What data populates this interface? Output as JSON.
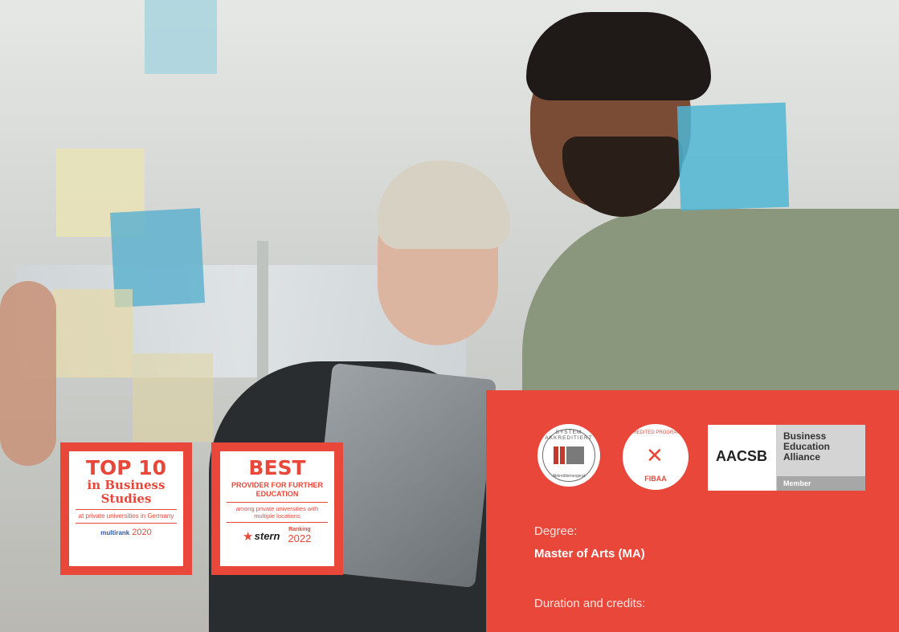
{
  "badges": {
    "top10": {
      "headline": "TOP 10",
      "subline": "in Business Studies",
      "detail": "at private universities in Germany",
      "source": "multirank",
      "year": "2020"
    },
    "best": {
      "headline": "BEST",
      "subline": "PROVIDER FOR FURTHER EDUCATION",
      "detail": "among private universities with multiple locations",
      "source": "stern",
      "ranking_label": "Ranking",
      "year": "2022"
    }
  },
  "accreditations": {
    "system": {
      "arc_text": "SYSTEM AKKREDITIERT",
      "bottom_text": "Akkreditierungsrat"
    },
    "fibaa": {
      "arc_text": "ACCREDITED PROGRAMME",
      "name": "FIBAA"
    },
    "aacsb": {
      "name": "AACSB",
      "lines": [
        "Business",
        "Education",
        "Alliance"
      ],
      "member": "Member"
    }
  },
  "info": {
    "degree_label": "Degree:",
    "degree_value": "Master of Arts (MA)",
    "duration_label": "Duration and credits:"
  },
  "colors": {
    "accent": "#e8473a"
  }
}
